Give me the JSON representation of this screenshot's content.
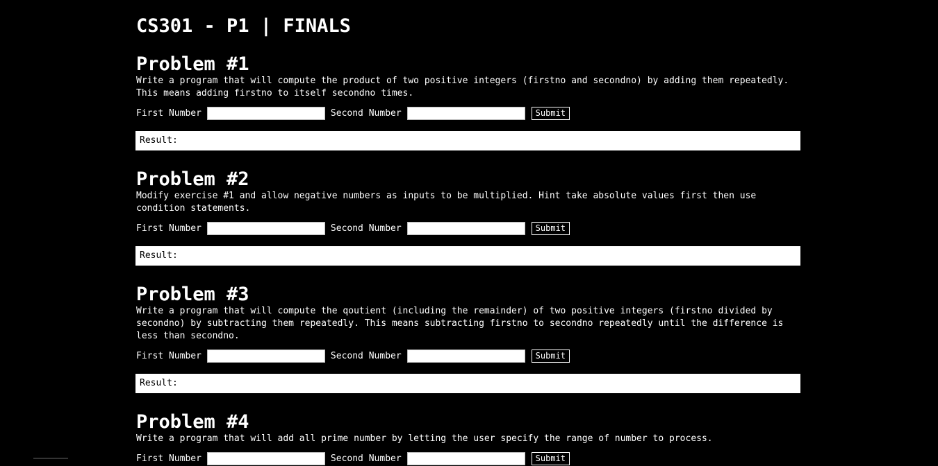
{
  "page": {
    "title": "CS301 - P1 | FINALS"
  },
  "form_labels": {
    "first": "First Number",
    "second": "Second Number",
    "submit": "Submit",
    "result": "Result:"
  },
  "problems": [
    {
      "title": "Problem #1",
      "description": "Write a program that will compute the product of two positive integers (firstno and secondno) by adding them repeatedly. This means adding firstno to itself secondno times."
    },
    {
      "title": "Problem #2",
      "description": "Modify exercise #1 and allow negative numbers as inputs to be multiplied. Hint take absolute values first then use condition statements."
    },
    {
      "title": "Problem #3",
      "description": "Write a program that will compute the qoutient (including the remainder) of two positive integers (firstno divided by secondno) by subtracting them repeatedly. This means subtracting firstno to secondno repeatedly until the difference is less than secondno."
    },
    {
      "title": "Problem #4",
      "description": "Write a program that will add all prime number by letting the user specify the range of number to process."
    }
  ],
  "colors": {
    "background": "#000000",
    "text": "#ffffff",
    "result_bg": "#ffffff"
  }
}
